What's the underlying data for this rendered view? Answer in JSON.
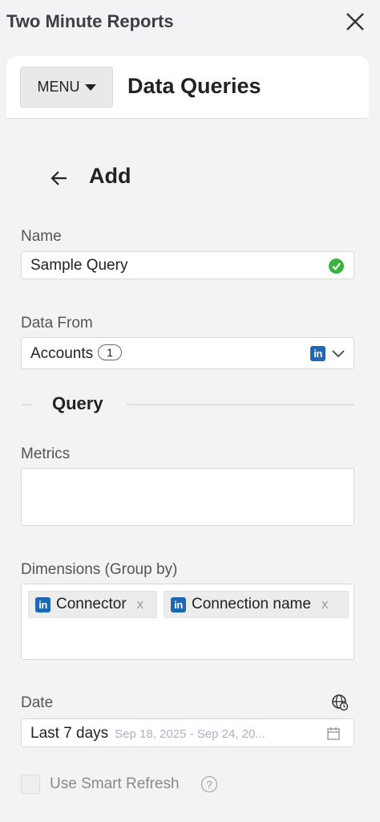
{
  "app": {
    "title": "Two Minute Reports"
  },
  "header": {
    "menu_label": "MENU",
    "page_title": "Data Queries"
  },
  "form": {
    "heading": "Add",
    "name": {
      "label": "Name",
      "value": "Sample Query"
    },
    "data_from": {
      "label": "Data From",
      "value": "Accounts",
      "count": "1"
    },
    "query_section": {
      "title": "Query"
    },
    "metrics": {
      "label": "Metrics",
      "value": ""
    },
    "dimensions": {
      "label": "Dimensions (Group by)",
      "chips": [
        {
          "label": "Connector",
          "remove": "x"
        },
        {
          "label": "Connection name",
          "remove": "x"
        }
      ]
    },
    "date": {
      "label": "Date",
      "value": "Last 7 days",
      "range": "Sep 18, 2025 - Sep 24, 20..."
    },
    "smart_refresh": {
      "label": "Use Smart Refresh",
      "checked": false,
      "help": "?"
    }
  },
  "icons": {
    "linkedin": {
      "name": "linkedin-icon",
      "text": "in",
      "color": "#1c68b5"
    },
    "success": {
      "name": "check-circle-icon",
      "color": "#3cb43c"
    }
  }
}
